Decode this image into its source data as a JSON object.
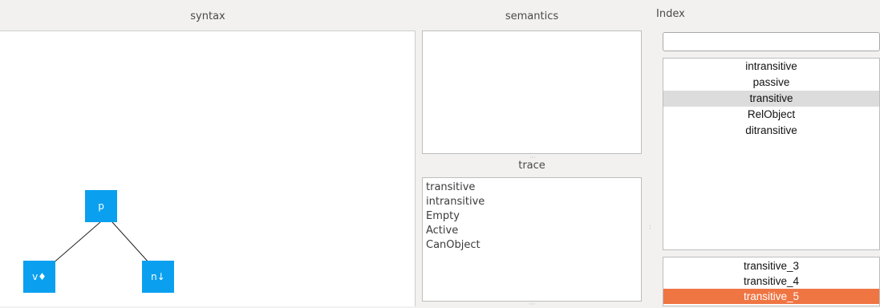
{
  "syntax": {
    "title": "syntax",
    "tree": {
      "root": "p",
      "left": "v♦",
      "right": "n↓"
    }
  },
  "semantics": {
    "title": "semantics"
  },
  "trace": {
    "title": "trace",
    "items": [
      "transitive",
      "intransitive",
      "Empty",
      "Active",
      "CanObject"
    ]
  },
  "index": {
    "title": "Index",
    "search_value": "",
    "items": [
      "intransitive",
      "passive",
      "transitive",
      "RelObject",
      "ditransitive"
    ],
    "selected": "transitive",
    "results": [
      "transitive_3",
      "transitive_4",
      "transitive_5"
    ],
    "active_result": "transitive_5",
    "colors": {
      "selected_bg": "#dcdcdc",
      "active_bg": "#ef7543"
    }
  }
}
